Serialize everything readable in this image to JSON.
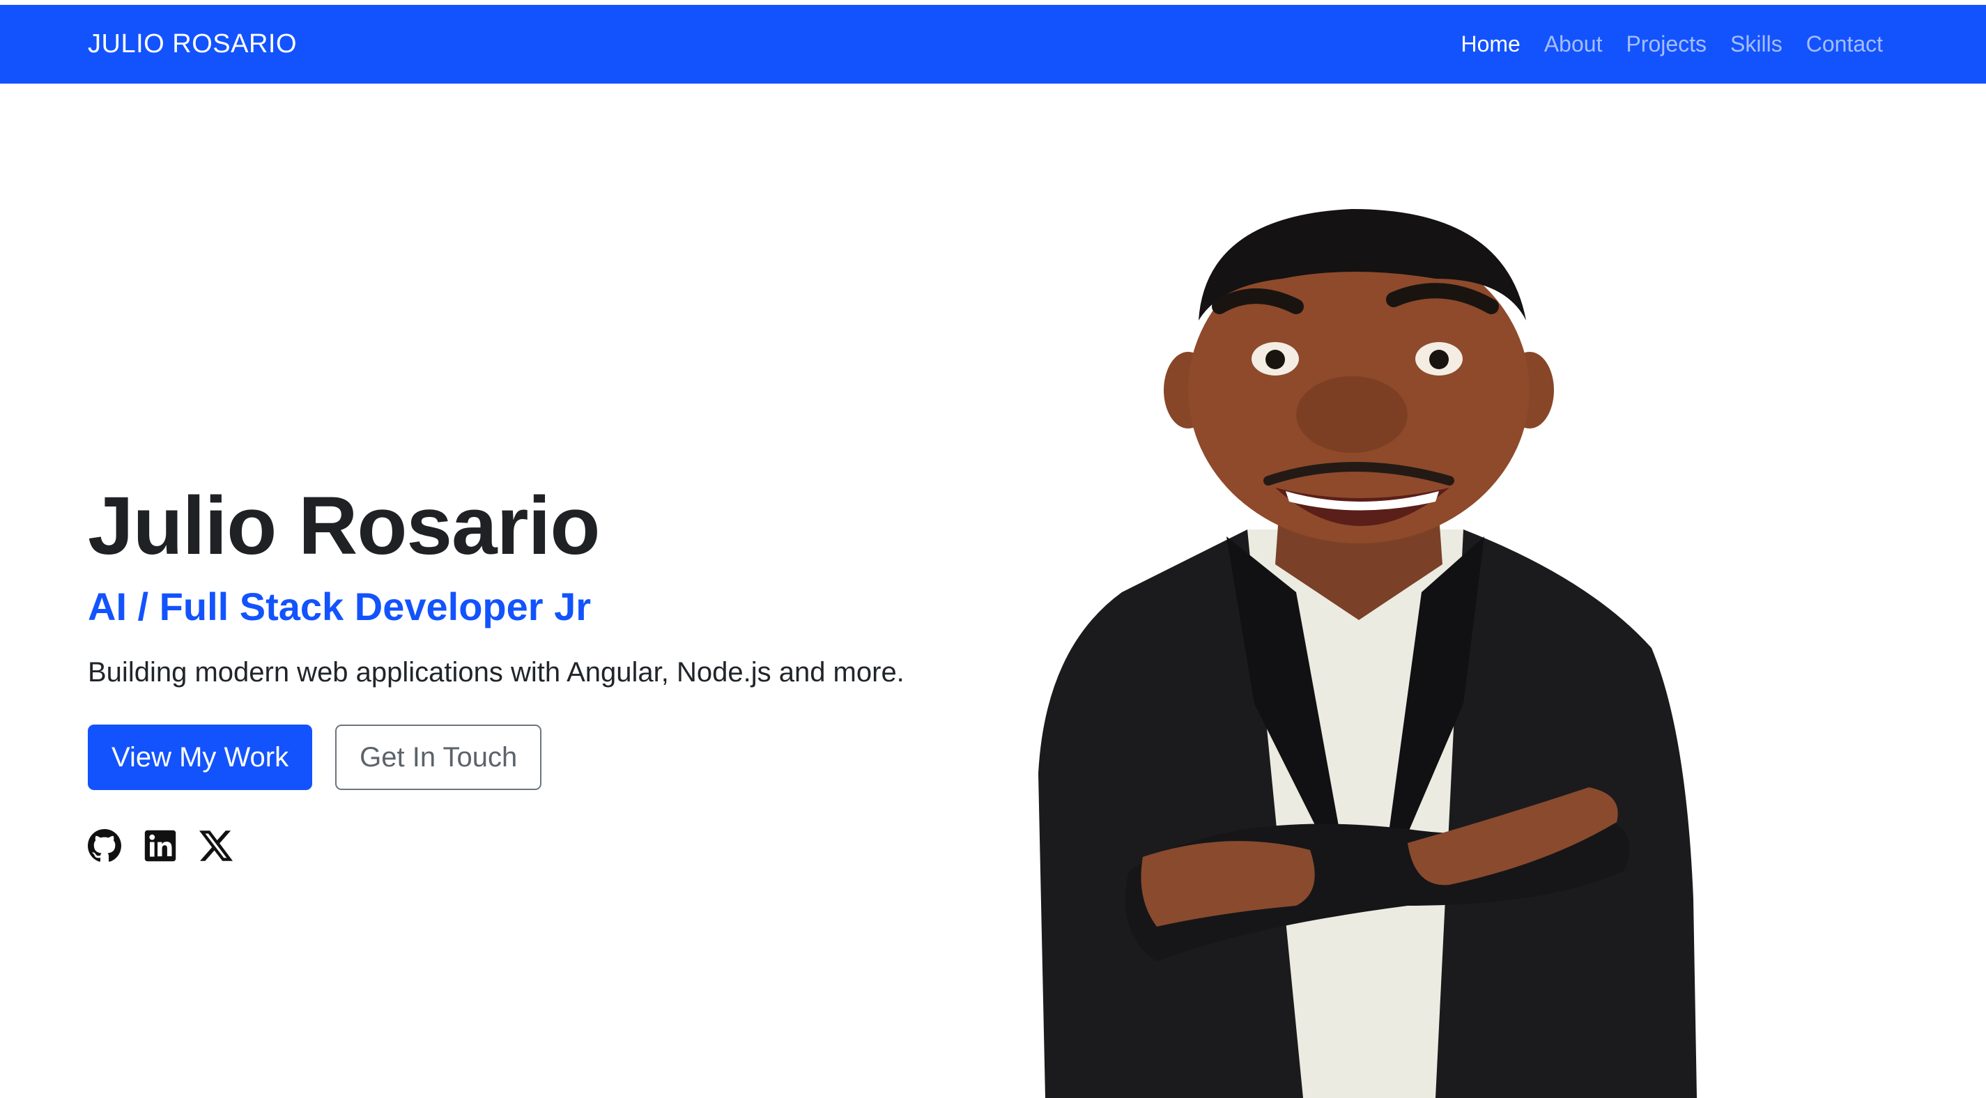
{
  "nav": {
    "brand": "JULIO ROSARIO",
    "links": [
      {
        "label": "Home",
        "active": true
      },
      {
        "label": "About",
        "active": false
      },
      {
        "label": "Projects",
        "active": false
      },
      {
        "label": "Skills",
        "active": false
      },
      {
        "label": "Contact",
        "active": false
      }
    ]
  },
  "hero": {
    "name": "Julio Rosario",
    "role": "AI / Full Stack Developer Jr",
    "description": "Building modern web applications with Angular, Node.js and more.",
    "primary_button": "View My Work",
    "secondary_button": "Get In Touch",
    "socials": [
      {
        "icon": "github-icon"
      },
      {
        "icon": "linkedin-icon"
      },
      {
        "icon": "x-icon"
      }
    ]
  },
  "colors": {
    "accent": "#1353fd",
    "text": "#212529",
    "outline": "#6c757d"
  }
}
